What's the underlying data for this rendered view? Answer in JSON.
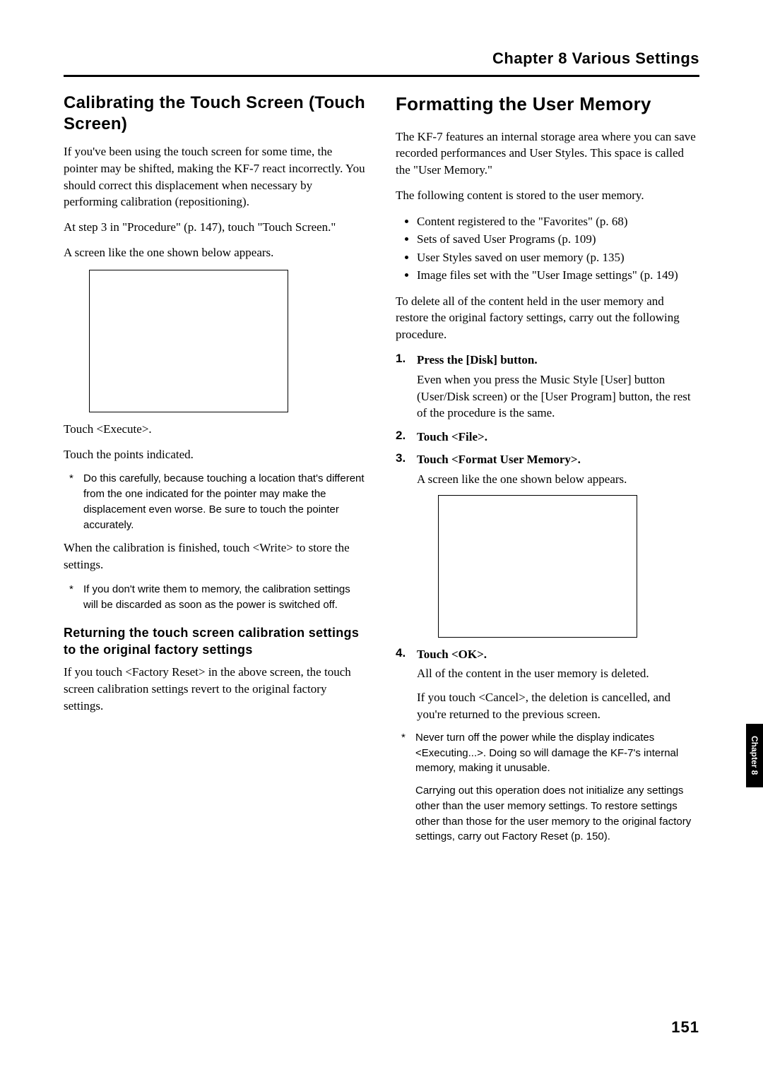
{
  "chapter_header": "Chapter 8  Various Settings",
  "side_tab": "Chapter 8",
  "page_number": "151",
  "left": {
    "title": "Calibrating the Touch Screen (Touch Screen)",
    "p1": "If you've been using the touch screen for some time, the pointer may be shifted, making the KF-7 react incorrectly. You should correct this displacement when necessary by performing calibration (repositioning).",
    "p2": "At step 3 in \"Procedure\" (p. 147), touch \"Touch Screen.\"",
    "p3": "A screen like the one shown below appears.",
    "p4": "Touch <Execute>.",
    "p5": "Touch the points indicated.",
    "note1": "Do this carefully, because touching a location that's different from the one indicated for the pointer may make the displacement even worse. Be sure to touch the pointer accurately.",
    "p6": "When the calibration is finished, touch <Write> to store the settings.",
    "note2": "If you don't write them to memory, the calibration settings will be discarded as soon as the power is switched off.",
    "sub_title": "Returning the touch screen calibration settings to the original factory settings",
    "p7": "If you touch <Factory Reset> in the above screen, the touch screen calibration settings revert to the original factory settings."
  },
  "right": {
    "title": "Formatting the User Memory",
    "p1": "The KF-7 features an internal storage area where you can save recorded performances and User Styles. This space is called the \"User Memory.\"",
    "p2": "The following content is stored to the user memory.",
    "bullets": [
      "Content registered to the \"Favorites\" (p. 68)",
      "Sets of saved User Programs (p. 109)",
      "User Styles saved on user memory (p. 135)",
      "Image files set with the \"User Image settings\" (p. 149)"
    ],
    "p3": "To delete all of the content held in the user memory and restore the original factory settings, carry out the following procedure.",
    "steps": [
      {
        "num": "1.",
        "bold": "Press the [Disk] button.",
        "body": "Even when you press the Music Style [User] button (User/Disk screen) or the [User Program] button, the rest of the procedure is the same."
      },
      {
        "num": "2.",
        "bold": "Touch <File>."
      },
      {
        "num": "3.",
        "bold": "Touch <Format User Memory>.",
        "body": "A screen like the one shown below appears."
      },
      {
        "num": "4.",
        "bold": "Touch <OK>.",
        "body": "All of the content in the user memory is deleted.",
        "body2": "If you touch <Cancel>, the deletion is cancelled, and you're returned to the previous screen."
      }
    ],
    "note1": "Never turn off the power while the display indicates <Executing...>. Doing so will damage the KF-7's internal memory, making it unusable.",
    "note2": "Carrying out this operation does not initialize any settings other than the user memory settings. To restore settings other than those for the user memory to the original factory settings, carry out Factory Reset (p. 150)."
  }
}
